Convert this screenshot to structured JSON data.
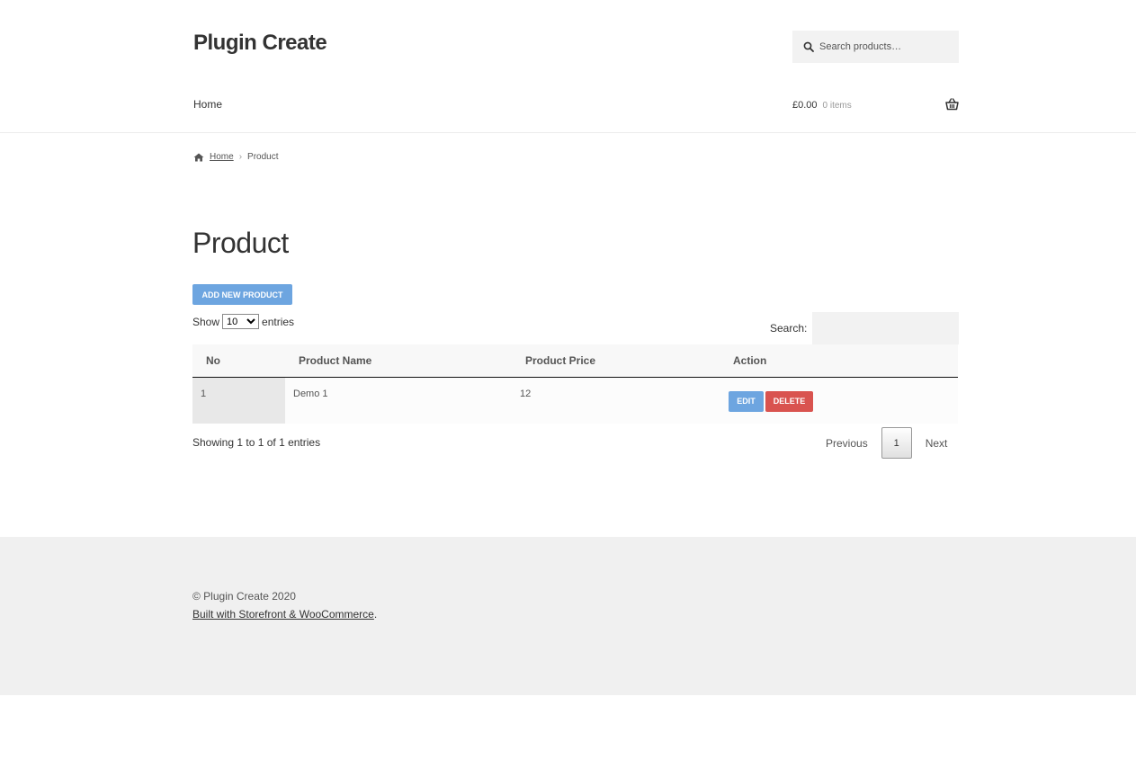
{
  "header": {
    "site_title": "Plugin Create",
    "search_placeholder": "Search products…",
    "nav_home": "Home",
    "cart_amount": "£0.00",
    "cart_count": "0 items"
  },
  "breadcrumb": {
    "home": "Home",
    "current": "Product"
  },
  "main": {
    "page_title": "Product",
    "add_button": "ADD NEW PRODUCT",
    "show_label": "Show",
    "entries_label": "entries",
    "page_length": "10",
    "page_length_options": [
      "10"
    ],
    "search_label": "Search:",
    "search_value": "",
    "columns": [
      "No",
      "Product Name",
      "Product Price",
      "Action"
    ],
    "rows": [
      {
        "no": "1",
        "name": "Demo 1",
        "price": "12",
        "edit": "EDIT",
        "delete": "DELETE"
      }
    ],
    "info": "Showing 1 to 1 of 1 entries",
    "pagination": {
      "previous": "Previous",
      "page": "1",
      "next": "Next"
    }
  },
  "footer": {
    "copyright": "© Plugin Create 2020",
    "built_with": "Built with Storefront & WooCommerce",
    "built_suffix": "."
  },
  "colors": {
    "primary_button": "#6da5e0",
    "danger_button": "#d9534f",
    "footer_bg": "#f0f0f0"
  }
}
